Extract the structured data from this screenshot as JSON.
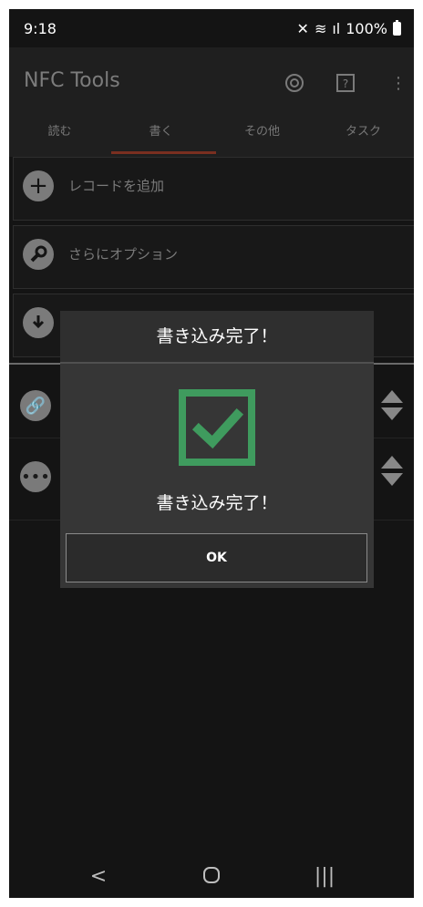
{
  "status": {
    "time": "9:18",
    "battery": "100%"
  },
  "app": {
    "title": "NFC Tools"
  },
  "tabs": [
    {
      "label": "読む"
    },
    {
      "label": "書く"
    },
    {
      "label": "その他"
    },
    {
      "label": "タスク"
    }
  ],
  "main": {
    "add_record": "レコードを追加",
    "more_options": "さらにオプション"
  },
  "dialog": {
    "title": "書き込み完了！",
    "message": "書き込み完了！",
    "ok_label": "OK",
    "accent_color": "#3f9b5e"
  }
}
